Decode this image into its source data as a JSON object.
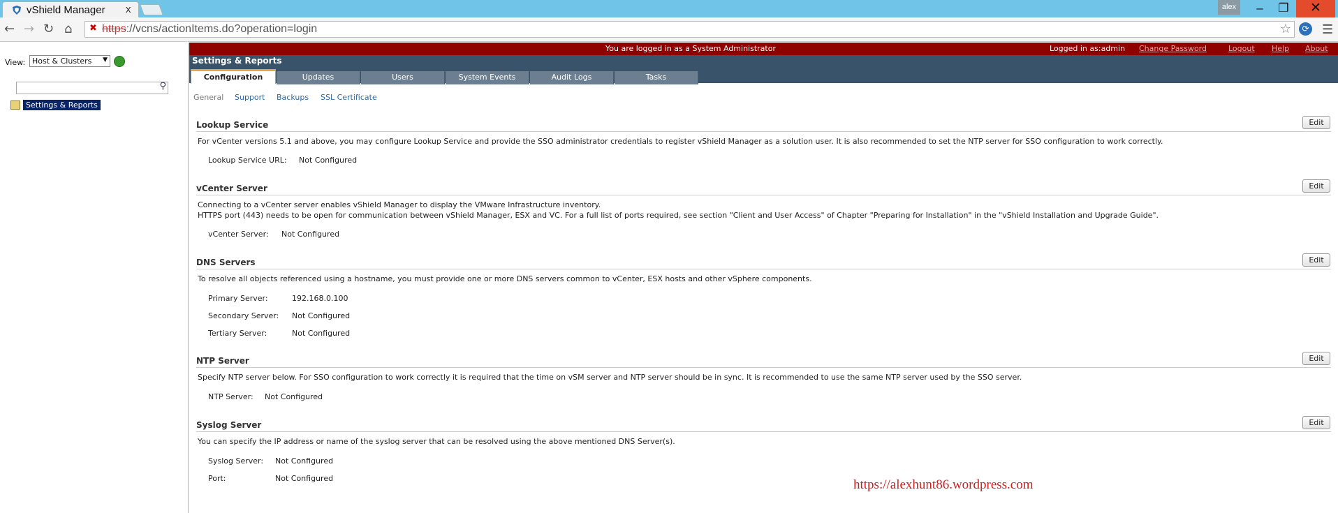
{
  "browser": {
    "tab_title": "vShield Manager",
    "tab_close": "x",
    "user_badge": "alex",
    "url_scheme": "https",
    "url_rest": "://vcns/actionItems.do?operation=login"
  },
  "left": {
    "view_label": "View:",
    "view_value": "Host & Clusters",
    "tree_item": "Settings & Reports"
  },
  "topbar": {
    "logged_role": "You are logged in as a System Administrator",
    "logged_as": "Logged in as:admin",
    "change_password": "Change Password",
    "logout": "Logout",
    "help": "Help",
    "about": "About"
  },
  "heading": "Settings & Reports",
  "tabs": [
    "Configuration",
    "Updates",
    "Users",
    "System Events",
    "Audit Logs",
    "Tasks"
  ],
  "subnav": [
    "General",
    "Support",
    "Backups",
    "SSL Certificate"
  ],
  "edit_label": "Edit",
  "sections": {
    "lookup": {
      "title": "Lookup Service",
      "desc": "For vCenter versions 5.1 and above, you may configure Lookup Service and provide the SSO administrator credentials to register vShield Manager as a solution user. It is also recommended to set the NTP server for SSO configuration to work correctly.",
      "url_label": "Lookup Service URL:",
      "url_value": "Not Configured"
    },
    "vcenter": {
      "title": "vCenter Server",
      "desc1": "Connecting to a vCenter server enables vShield Manager to display the VMware Infrastructure inventory.",
      "desc2": "HTTPS port (443) needs to be open for communication between vShield Manager, ESX and VC. For a full list of ports required, see section \"Client and User Access\" of Chapter \"Preparing for Installation\" in the \"vShield Installation and Upgrade Guide\".",
      "server_label": "vCenter Server:",
      "server_value": "Not Configured"
    },
    "dns": {
      "title": "DNS Servers",
      "desc": "To resolve all objects referenced using a hostname, you must provide one or more DNS servers common to vCenter, ESX hosts and other vSphere components.",
      "primary_label": "Primary Server:",
      "primary_value": "192.168.0.100",
      "secondary_label": "Secondary Server:",
      "secondary_value": "Not Configured",
      "tertiary_label": "Tertiary Server:",
      "tertiary_value": "Not Configured"
    },
    "ntp": {
      "title": "NTP Server",
      "desc": "Specify NTP server below. For SSO configuration to work correctly it is required that the time on vSM server and NTP server should be in sync. It is recommended to use the same NTP server used by the SSO server.",
      "server_label": "NTP Server:",
      "server_value": "Not Configured"
    },
    "syslog": {
      "title": "Syslog Server",
      "desc": "You can specify the IP address or name of the syslog server that can be resolved using the above mentioned DNS Server(s).",
      "server_label": "Syslog Server:",
      "server_value": "Not Configured",
      "port_label": "Port:",
      "port_value": "Not Configured"
    }
  },
  "watermark": "https://alexhunt86.wordpress.com"
}
